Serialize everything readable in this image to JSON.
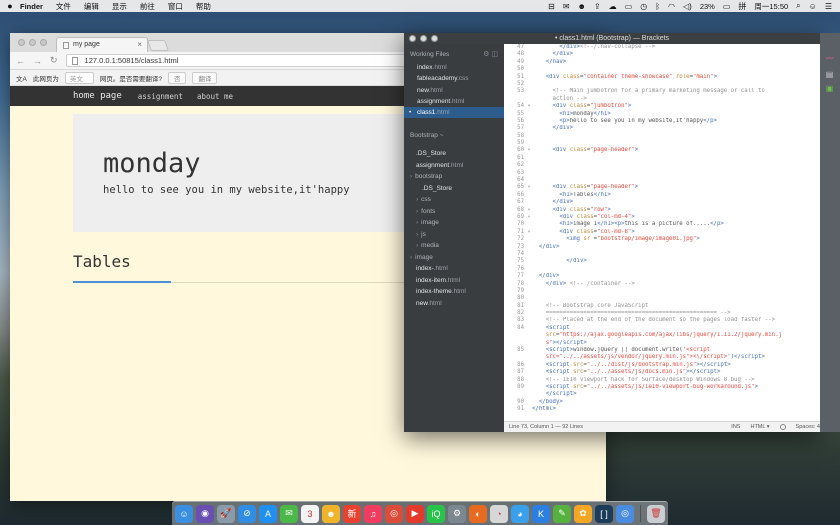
{
  "menubar": {
    "app_name": "Finder",
    "items": [
      "文件",
      "编辑",
      "显示",
      "前往",
      "窗口",
      "帮助"
    ],
    "battery": "23%",
    "clock": "周一15:50"
  },
  "browser": {
    "tab_title": "my page",
    "url": "127.0.0.1:50815/class1.html",
    "translate_bar": {
      "label": "此网页为",
      "language": "英文",
      "question": "网页。是否需要翻译?",
      "no_button": "否",
      "translate_button": "翻译"
    }
  },
  "site": {
    "nav": {
      "brand": "home page",
      "links": [
        "assignment",
        "about me"
      ]
    },
    "jumbotron": {
      "title": "monday",
      "text": "hello to see you in my website,it'happy"
    },
    "tables_heading": "Tables"
  },
  "brackets": {
    "title": "• class1.html (Bootstrap) — Brackets",
    "sidebar": {
      "working_files_label": "Working Files",
      "working_files": [
        {
          "name": "index",
          "ext": ".html",
          "active": false
        },
        {
          "name": "fableacademy",
          "ext": ".css",
          "active": false
        },
        {
          "name": "new",
          "ext": ".html",
          "active": false
        },
        {
          "name": "assignment",
          "ext": ".html",
          "active": false
        },
        {
          "name": "class1",
          "ext": ".html",
          "active": true
        }
      ],
      "project_label": "Bootstrap ~",
      "tree": [
        {
          "name": ".DS_Store",
          "ext": "",
          "depth": 0,
          "folder": false
        },
        {
          "name": "assignment",
          "ext": ".html",
          "depth": 0,
          "folder": false
        },
        {
          "name": "bootstrap",
          "ext": "",
          "depth": 0,
          "folder": true
        },
        {
          "name": ".DS_Store",
          "ext": "",
          "depth": 1,
          "folder": false
        },
        {
          "name": "css",
          "ext": "",
          "depth": 1,
          "folder": true
        },
        {
          "name": "fonts",
          "ext": "",
          "depth": 1,
          "folder": true
        },
        {
          "name": "image",
          "ext": "",
          "depth": 1,
          "folder": true
        },
        {
          "name": "js",
          "ext": "",
          "depth": 1,
          "folder": true
        },
        {
          "name": "media",
          "ext": "",
          "depth": 1,
          "folder": true
        },
        {
          "name": "image",
          "ext": "",
          "depth": 0,
          "folder": true
        },
        {
          "name": "index-",
          "ext": ".html",
          "depth": 0,
          "folder": false
        },
        {
          "name": "index-item",
          "ext": ".html",
          "depth": 0,
          "folder": false
        },
        {
          "name": "index-theme",
          "ext": ".html",
          "depth": 0,
          "folder": false
        },
        {
          "name": "new",
          "ext": ".html",
          "depth": 0,
          "folder": false
        }
      ]
    },
    "code_lines": [
      {
        "n": "47",
        "f": "",
        "t": "",
        "h": "        <span class=\"tag\">&lt;/div&gt;</span><span class=\"cmt\">&lt;!--/.nav-collapse --&gt;</span>"
      },
      {
        "n": "48",
        "f": "",
        "t": "",
        "h": "      <span class=\"tag\">&lt;/div&gt;</span>"
      },
      {
        "n": "49",
        "f": "",
        "t": "",
        "h": "    <span class=\"tag\">&lt;/nav&gt;</span>"
      },
      {
        "n": "50",
        "f": "",
        "t": "",
        "h": ""
      },
      {
        "n": "51",
        "f": "",
        "t": "",
        "h": "    <span class=\"tag\">&lt;div</span> <span class=\"attr\">class</span>=<span class=\"str\">\"container theme-showcase\"</span> <span class=\"attr\">role</span>=<span class=\"str\">\"main\"</span><span class=\"tag\">&gt;</span>"
      },
      {
        "n": "52",
        "f": "",
        "t": "",
        "h": ""
      },
      {
        "n": "53",
        "f": "",
        "t": "tall",
        "h": "      <span class=\"cmt\">&lt;!-- Main jumbotron for a primary marketing message or call to\n      action --&gt;</span>"
      },
      {
        "n": "54",
        "f": "▾",
        "t": "",
        "h": "      <span class=\"tag\">&lt;div</span> <span class=\"attr\">class</span>=<span class=\"str\">\"jumbotron\"</span><span class=\"tag\">&gt;</span>"
      },
      {
        "n": "55",
        "f": "",
        "t": "",
        "h": "        <span class=\"tag\">&lt;h1&gt;</span>monday<span class=\"tag\">&lt;/h1&gt;</span>"
      },
      {
        "n": "56",
        "f": "",
        "t": "",
        "h": "        <span class=\"tag\">&lt;p&gt;</span>hello to see you in my website,it'happy<span class=\"tag\">&lt;/p&gt;</span>"
      },
      {
        "n": "57",
        "f": "",
        "t": "",
        "h": "      <span class=\"tag\">&lt;/div&gt;</span>"
      },
      {
        "n": "58",
        "f": "",
        "t": "",
        "h": ""
      },
      {
        "n": "59",
        "f": "",
        "t": "",
        "h": ""
      },
      {
        "n": "60",
        "f": "▾",
        "t": "",
        "h": "      <span class=\"tag\">&lt;div</span> <span class=\"attr\">class</span>=<span class=\"str\">\"page-header\"</span><span class=\"tag\">&gt;</span>"
      },
      {
        "n": "61",
        "f": "",
        "t": "",
        "h": ""
      },
      {
        "n": "62",
        "f": "",
        "t": "",
        "h": ""
      },
      {
        "n": "63",
        "f": "",
        "t": "",
        "h": ""
      },
      {
        "n": "64",
        "f": "",
        "t": "",
        "h": ""
      },
      {
        "n": "65",
        "f": "▾",
        "t": "",
        "h": "      <span class=\"tag\">&lt;div</span> <span class=\"attr\">class</span>=<span class=\"str\">\"page-header\"</span><span class=\"tag\">&gt;</span>"
      },
      {
        "n": "66",
        "f": "",
        "t": "",
        "h": "        <span class=\"tag\">&lt;h1&gt;</span>Tables<span class=\"tag\">&lt;/h1&gt;</span>"
      },
      {
        "n": "67",
        "f": "",
        "t": "",
        "h": "      <span class=\"tag\">&lt;/div&gt;</span>"
      },
      {
        "n": "68",
        "f": "▾",
        "t": "",
        "h": "      <span class=\"tag\">&lt;div</span> <span class=\"attr\">class</span>=<span class=\"str\">\"row\"</span><span class=\"tag\">&gt;</span>"
      },
      {
        "n": "69",
        "f": "▾",
        "t": "",
        "h": "        <span class=\"tag\">&lt;div</span> <span class=\"attr\">class</span>=<span class=\"str\">\"col-md-4\"</span><span class=\"tag\">&gt;</span>"
      },
      {
        "n": "70",
        "f": "",
        "t": "",
        "h": "        <span class=\"tag\">&lt;h1&gt;</span>image 1<span class=\"tag\">&lt;/h1&gt;&lt;p&gt;</span>this is a picture of.....<span class=\"tag\">&lt;/p&gt;</span>"
      },
      {
        "n": "71",
        "f": "▾",
        "t": "",
        "h": "        <span class=\"tag\">&lt;div</span> <span class=\"attr\">class</span>=<span class=\"str\">\"col-md-8\"</span><span class=\"tag\">&gt;</span>"
      },
      {
        "n": "72",
        "f": "",
        "t": "",
        "h": "          <span class=\"tag\">&lt;img</span> <span class=\"attr\">sr</span> =<span class=\"str\">\"bootstrap/image/image01.jpg\"</span><span class=\"tag\">&gt;</span>"
      },
      {
        "n": "73",
        "f": "",
        "t": "",
        "h": "  <span class=\"tag\">&lt;/div&gt;</span>"
      },
      {
        "n": "74",
        "f": "",
        "t": "",
        "h": ""
      },
      {
        "n": "75",
        "f": "",
        "t": "",
        "h": "          <span class=\"tag\">&lt;/div&gt;</span>"
      },
      {
        "n": "76",
        "f": "",
        "t": "",
        "h": ""
      },
      {
        "n": "77",
        "f": "",
        "t": "",
        "h": "  <span class=\"tag\">&lt;/div&gt;</span>"
      },
      {
        "n": "78",
        "f": "",
        "t": "",
        "h": "    <span class=\"tag\">&lt;/div&gt;</span> <span class=\"cmt\">&lt;!-- /container --&gt;</span>"
      },
      {
        "n": "79",
        "f": "",
        "t": "",
        "h": ""
      },
      {
        "n": "80",
        "f": "",
        "t": "",
        "h": ""
      },
      {
        "n": "81",
        "f": "",
        "t": "",
        "h": "    <span class=\"cmt\">&lt;!-- Bootstrap core JavaScript</span>"
      },
      {
        "n": "82",
        "f": "",
        "t": "",
        "h": "    <span class=\"cmt\">================================================== --&gt;</span>"
      },
      {
        "n": "83",
        "f": "",
        "t": "",
        "h": "    <span class=\"cmt\">&lt;!-- Placed at the end of the document so the pages load faster --&gt;</span>"
      },
      {
        "n": "84",
        "f": "",
        "t": "",
        "h": "    <span class=\"tag\">&lt;script</span>"
      },
      {
        "n": "",
        "f": "",
        "t": "",
        "h": "    <span class=\"attr\">src</span>=<span class=\"str\">\"https://ajax.googleapis.com/ajax/libs/jquery/1.11.2/jquery.min.j</span>"
      },
      {
        "n": "",
        "f": "",
        "t": "",
        "h": "    <span class=\"str\">s\"</span><span class=\"tag\">&gt;&lt;/script&gt;</span>"
      },
      {
        "n": "85",
        "f": "",
        "t": "",
        "h": "    <span class=\"tag\">&lt;script&gt;</span>window.jQuery || document.write('<span class=\"str\">&lt;script</span>"
      },
      {
        "n": "",
        "f": "",
        "t": "",
        "h": "    <span class=\"str\">src=\"../../assets/js/vendor/jquery.min.js\"&gt;&lt;\\/script&gt;</span>')<span class=\"tag\">&lt;/script&gt;</span>"
      },
      {
        "n": "86",
        "f": "",
        "t": "",
        "h": "    <span class=\"tag\">&lt;script</span> <span class=\"attr\">src</span>=<span class=\"str\">\"../../dist/js/bootstrap.min.js\"</span><span class=\"tag\">&gt;&lt;/script&gt;</span>"
      },
      {
        "n": "87",
        "f": "",
        "t": "",
        "h": "    <span class=\"tag\">&lt;script</span> <span class=\"attr\">src</span>=<span class=\"str\">\"../../assets/js/docs.min.js\"</span><span class=\"tag\">&gt;&lt;/script&gt;</span>"
      },
      {
        "n": "88",
        "f": "",
        "t": "",
        "h": "    <span class=\"cmt\">&lt;!-- IE10 viewport hack for Surface/desktop Windows 8 bug --&gt;</span>"
      },
      {
        "n": "89",
        "f": "",
        "t": "",
        "h": "    <span class=\"tag\">&lt;script</span> <span class=\"attr\">src</span>=<span class=\"str\">\"../../assets/js/ie10-viewport-bug-workaround.js\"</span><span class=\"tag\">&gt;</span>"
      },
      {
        "n": "",
        "f": "",
        "t": "",
        "h": "    <span class=\"tag\">&lt;/script&gt;</span>"
      },
      {
        "n": "90",
        "f": "",
        "t": "",
        "h": "  <span class=\"tag\">&lt;/body&gt;</span>"
      },
      {
        "n": "91",
        "f": "",
        "t": "",
        "h": "<span class=\"tag\">&lt;/html&gt;</span>"
      }
    ],
    "status": {
      "position": "Line 73, Column 1 — 92 Lines",
      "ins": "INS",
      "mode": "HTML ▾",
      "spaces": "Spaces: 4"
    }
  },
  "dock": {
    "icons": [
      {
        "name": "finder-icon",
        "glyph": "☺",
        "color": "#3b8fe0"
      },
      {
        "name": "siri-icon",
        "glyph": "◉",
        "color": "#6a4fb3"
      },
      {
        "name": "launchpad-icon",
        "glyph": "🚀",
        "color": "#8a9aa8"
      },
      {
        "name": "safari-icon",
        "glyph": "⊘",
        "color": "#2f8de4"
      },
      {
        "name": "app-store-icon",
        "glyph": "A",
        "color": "#1f8ff0"
      },
      {
        "name": "wechat-icon",
        "glyph": "✉",
        "color": "#4cb848"
      },
      {
        "name": "calendar-icon",
        "glyph": "3",
        "color": "#f4f4f4"
      },
      {
        "name": "qq-icon",
        "glyph": "☻",
        "color": "#f0b42a"
      },
      {
        "name": "news-icon",
        "glyph": "新",
        "color": "#e8412f"
      },
      {
        "name": "music-icon",
        "glyph": "♫",
        "color": "#f23c5f"
      },
      {
        "name": "chrome-icon",
        "glyph": "◎",
        "color": "#dd4b39"
      },
      {
        "name": "video-icon",
        "glyph": "▶",
        "color": "#e33a2c"
      },
      {
        "name": "iqiyi-icon",
        "glyph": "iQ",
        "color": "#27c44a"
      },
      {
        "name": "system-preferences-icon",
        "glyph": "⚙",
        "color": "#7d8790"
      },
      {
        "name": "firefox-icon",
        "glyph": "◐",
        "color": "#e66a1f"
      },
      {
        "name": "preview-icon",
        "glyph": "◔",
        "color": "#d7d7d7"
      },
      {
        "name": "baidu-netdisk-icon",
        "glyph": "◕",
        "color": "#3aa0ec"
      },
      {
        "name": "kugou-icon",
        "glyph": "K",
        "color": "#2a7fe0"
      },
      {
        "name": "evernote-icon",
        "glyph": "✎",
        "color": "#57b13e"
      },
      {
        "name": "photos-icon",
        "glyph": "✿",
        "color": "#f5a623"
      },
      {
        "name": "brackets-icon",
        "glyph": "[ ]",
        "color": "#1c3d5a"
      },
      {
        "name": "chrome-app-icon",
        "glyph": "◎",
        "color": "#4a8de0"
      },
      {
        "name": "trash-icon",
        "glyph": "🗑",
        "color": "#c9ccd0"
      }
    ]
  }
}
